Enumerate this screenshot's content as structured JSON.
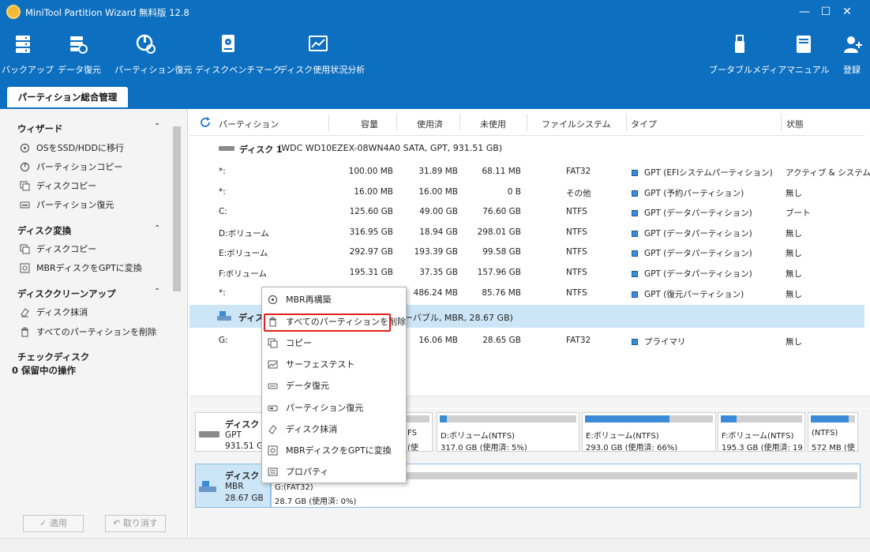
{
  "window": {
    "title": "MiniTool Partition Wizard 無料版 12.8",
    "minimize": "—",
    "maximize": "☐",
    "close": "✕"
  },
  "toolbar": [
    {
      "label": "バックアップ",
      "icon": "backup-icon"
    },
    {
      "label": "データ復元",
      "icon": "data-recovery-icon"
    },
    {
      "label": "パーティション復元",
      "icon": "partition-recovery-icon"
    },
    {
      "label": "ディスクベンチマーク",
      "icon": "disk-benchmark-icon"
    },
    {
      "label": "ディスク使用状況分析",
      "icon": "disk-usage-analysis-icon"
    },
    {
      "label": "ブータブルメディア",
      "icon": "bootable-media-icon"
    },
    {
      "label": "マニュアル",
      "icon": "manual-icon"
    },
    {
      "label": "登録",
      "icon": "register-icon"
    }
  ],
  "main_tab": "パーティション総合管理",
  "sidebar": {
    "wizard": {
      "title": "ウィザード",
      "items": [
        "OSをSSD/HDDに移行",
        "パーティションコピー",
        "ディスクコピー",
        "パーティション復元"
      ]
    },
    "disk_convert": {
      "title": "ディスク変換",
      "items": [
        "ディスクコピー",
        "MBRディスクをGPTに変換"
      ]
    },
    "disk_cleanup": {
      "title": "ディスククリーンアップ",
      "items": [
        "ディスク抹消",
        "すべてのパーティションを削除"
      ]
    },
    "check_disk": {
      "title": "チェックディスク"
    },
    "pending": "0 保留中の操作",
    "apply": "✓  適用",
    "undo": "↶  取り消す"
  },
  "table": {
    "headers": [
      "パーティション",
      "容量",
      "使用済",
      "未使用",
      "ファイルシステム",
      "タイプ",
      "状態"
    ],
    "disk1": {
      "label": "ディスク 1",
      "info": "(WDC WD10EZEX-08WN4A0 SATA, GPT, 931.51 GB)"
    },
    "disk1_rows": [
      {
        "name": "*:",
        "cap": "100.00 MB",
        "used": "31.89 MB",
        "free": "68.11 MB",
        "fs": "FAT32",
        "type": "GPT (EFIシステムパーティション)",
        "status": "アクティブ & システム"
      },
      {
        "name": "*:",
        "cap": "16.00 MB",
        "used": "16.00 MB",
        "free": "0 B",
        "fs": "その他",
        "type": "GPT (予約パーティション)",
        "status": "無し"
      },
      {
        "name": "C:",
        "cap": "125.60 GB",
        "used": "49.00 GB",
        "free": "76.60 GB",
        "fs": "NTFS",
        "type": "GPT (データパーティション)",
        "status": "ブート"
      },
      {
        "name": "D:ボリューム",
        "cap": "316.95 GB",
        "used": "18.94 GB",
        "free": "298.01 GB",
        "fs": "NTFS",
        "type": "GPT (データパーティション)",
        "status": "無し"
      },
      {
        "name": "E:ボリューム",
        "cap": "292.97 GB",
        "used": "193.39 GB",
        "free": "99.58 GB",
        "fs": "NTFS",
        "type": "GPT (データパーティション)",
        "status": "無し"
      },
      {
        "name": "F:ボリューム",
        "cap": "195.31 GB",
        "used": "37.35 GB",
        "free": "157.96 GB",
        "fs": "NTFS",
        "type": "GPT (データパーティション)",
        "status": "無し"
      },
      {
        "name": "*:",
        "cap": "",
        "used": "486.24 MB",
        "free": "85.76 MB",
        "fs": "NTFS",
        "type": "GPT (復元パーティション)",
        "status": "無し"
      }
    ],
    "disk2": {
      "label": "ディス",
      "info": "ーバブル, MBR, 28.67 GB)"
    },
    "disk2_rows": [
      {
        "name": "G:",
        "cap": "",
        "used": "16.06 MB",
        "free": "28.65 GB",
        "fs": "FAT32",
        "type": "プライマリ",
        "status": "無し"
      }
    ]
  },
  "diskmap": {
    "disk1": {
      "name": "ディスク 1",
      "type": "GPT",
      "size": "931.51 GB"
    },
    "disk1_segs": [
      {
        "t1": "FS",
        "t2": "(使",
        "fill": 0.0
      },
      {
        "t1": "D:ボリューム(NTFS)",
        "t2": "317.0 GB (使用済: 5%)",
        "fill": 0.05
      },
      {
        "t1": "E:ボリューム(NTFS)",
        "t2": "293.0 GB (使用済: 66%)",
        "fill": 0.66
      },
      {
        "t1": "F:ボリューム(NTFS)",
        "t2": "195.3 GB (使用済: 19",
        "fill": 0.19
      },
      {
        "t1": "(NTFS)",
        "t2": "572 MB (使",
        "fill": 0.85
      }
    ],
    "disk2": {
      "name": "ディスク 2",
      "type": "MBR",
      "size": "28.67 GB"
    },
    "disk2_seg": {
      "t1": "G:(FAT32)",
      "t2": "28.7 GB (使用済: 0%)",
      "fill": 0.0
    }
  },
  "context_menu": [
    {
      "label": "MBR再構築",
      "icon": "rebuild-mbr-icon"
    },
    {
      "label": "すべてのパーティションを削除",
      "icon": "trash-icon"
    },
    {
      "label": "コピー",
      "icon": "copy-icon"
    },
    {
      "label": "サーフェステスト",
      "icon": "surface-test-icon"
    },
    {
      "label": "データ復元",
      "icon": "data-recovery-icon"
    },
    {
      "label": "パーティション復元",
      "icon": "partition-recovery-icon"
    },
    {
      "label": "ディスク抹消",
      "icon": "eraser-icon"
    },
    {
      "label": "MBRディスクをGPTに変換",
      "icon": "convert-icon"
    },
    {
      "label": "プロパティ",
      "icon": "properties-icon"
    }
  ],
  "colors": {
    "header": "#0c6fc0",
    "accent": "#3b8bd9",
    "selected_row": "#cde6f7",
    "highlight_border": "#e3201b"
  }
}
